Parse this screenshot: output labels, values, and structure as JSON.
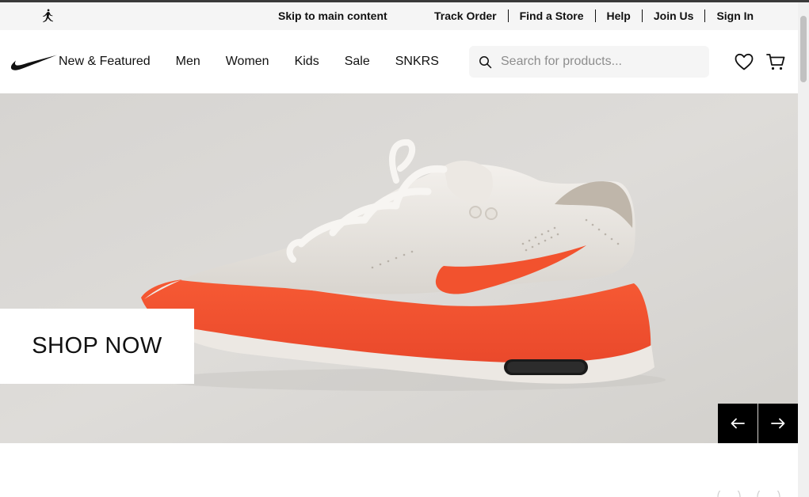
{
  "utility": {
    "skip_label": "Skip to main content",
    "links": [
      "Track Order",
      "Find a Store",
      "Help",
      "Join Us",
      "Sign In"
    ]
  },
  "nav": {
    "items": [
      "New & Featured",
      "Men",
      "Women",
      "Kids",
      "Sale",
      "SNKRS"
    ],
    "search_placeholder": "Search for products..."
  },
  "hero": {
    "cta_label": "SHOP NOW"
  },
  "icons": {
    "brand": "nike-swoosh-icon",
    "sub_brand": "jordan-jumpman-icon",
    "search": "search-icon",
    "wishlist": "heart-icon",
    "cart": "cart-icon",
    "prev": "arrow-left-icon",
    "next": "arrow-right-icon"
  },
  "colors": {
    "text": "#111111",
    "utility_bg": "#f5f5f5",
    "hero_bg": "#dad8d5",
    "shoe_accent": "#f2522e",
    "carousel_btn": "#000000"
  }
}
